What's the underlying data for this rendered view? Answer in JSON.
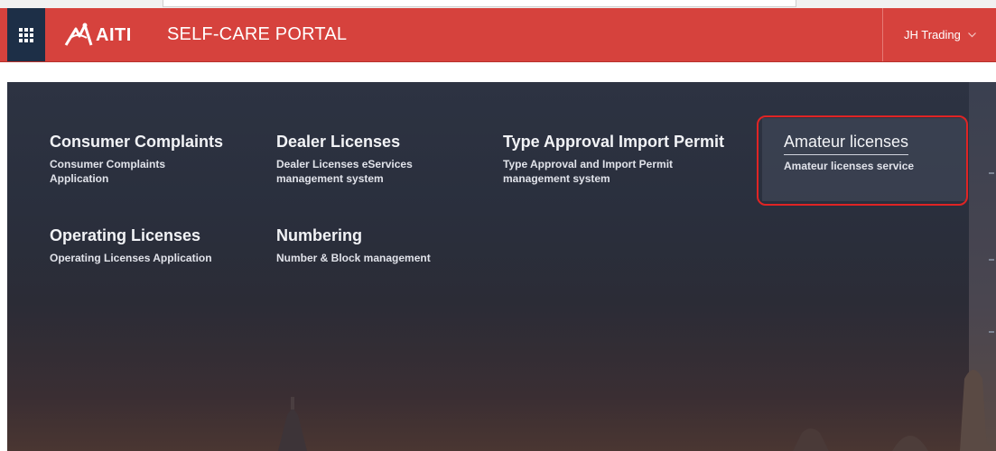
{
  "header": {
    "logo_text": "AITI",
    "title": "SELF-CARE PORTAL",
    "user_name": "JH Trading",
    "app_launcher_icon": "waffle-grid-icon",
    "logo_icon": "aiti-bird-icon",
    "user_caret_icon": "chevron-down-icon"
  },
  "colors": {
    "header_bg": "#d6423d",
    "launcher_bg": "#1d2f47",
    "highlight": "#e02424"
  },
  "tiles": [
    {
      "title": "Consumer Complaints",
      "description": "Consumer Complaints Application"
    },
    {
      "title": "Dealer Licenses",
      "description": "Dealer Licenses eServices management system"
    },
    {
      "title": "Type Approval Import Permit",
      "description": "Type Approval and Import Permit management system"
    },
    {
      "title": "Amateur licenses",
      "description": "Amateur licenses service"
    },
    {
      "title": "Operating Licenses",
      "description": "Operating Licenses Application"
    },
    {
      "title": "Numbering",
      "description": "Number & Block management"
    }
  ]
}
